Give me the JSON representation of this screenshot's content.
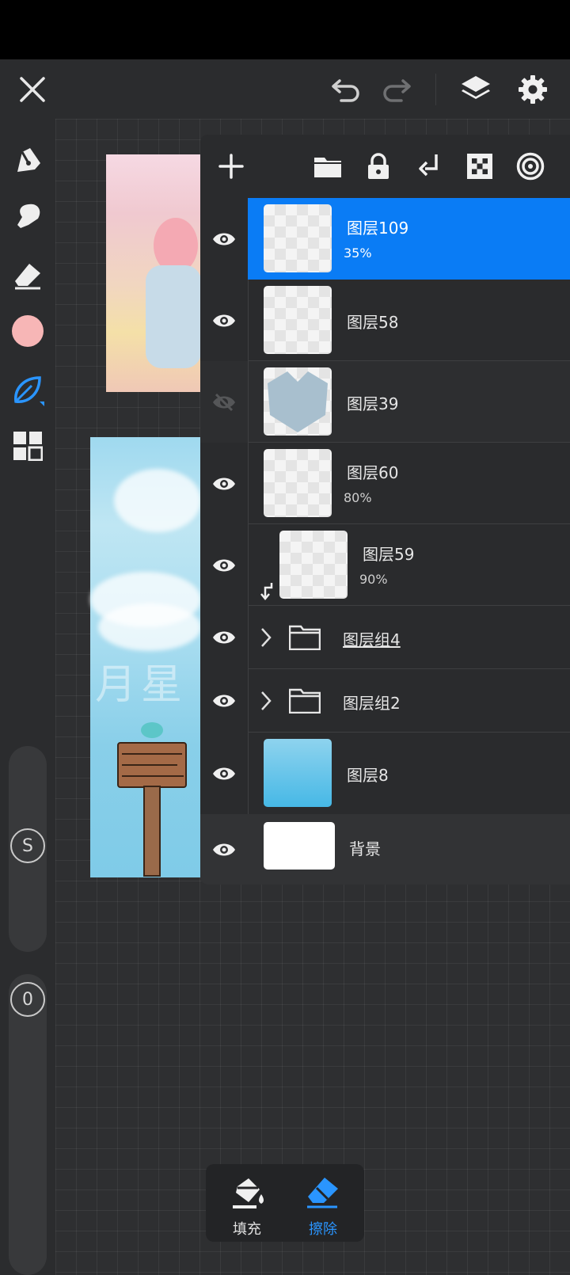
{
  "top_bar": {
    "close_icon": "close-icon",
    "undo_icon": "undo-icon",
    "redo_icon": "redo-icon",
    "layers_icon": "layers-icon",
    "settings_icon": "gear-icon"
  },
  "left_toolbar": {
    "tools": [
      "brush-icon",
      "smudge-icon",
      "eraser-icon",
      "color-swatch",
      "leaf-brush-icon",
      "grid-menu-icon"
    ],
    "active_tool": "leaf-brush-icon",
    "current_color": "#f7b6b6",
    "size_slider_label": "S",
    "opacity_slider_label": "0"
  },
  "artwork": {
    "watermark": "月星"
  },
  "layers_panel": {
    "toolbar": [
      "add-layer-icon",
      "folder-icon",
      "lock-icon",
      "merge-down-icon",
      "alpha-lock-icon",
      "blend-mode-icon"
    ],
    "layers": [
      {
        "name": "图层109",
        "opacity": "35%",
        "selected": true,
        "visible": true
      },
      {
        "name": "图层58",
        "opacity": "",
        "selected": false,
        "visible": true
      },
      {
        "name": "图层39",
        "opacity": "",
        "selected": false,
        "visible": false
      },
      {
        "name": "图层60",
        "opacity": "80%",
        "selected": false,
        "visible": true
      },
      {
        "name": "图层59",
        "opacity": "90%",
        "selected": false,
        "visible": true,
        "clipped": true
      },
      {
        "name": "图层组4",
        "group": true,
        "visible": true
      },
      {
        "name": "图层组2",
        "group": true,
        "visible": true
      },
      {
        "name": "图层8",
        "opacity": "",
        "visible": true
      },
      {
        "name": "背景",
        "opacity": "",
        "visible": true
      }
    ]
  },
  "fill_erase": {
    "fill_label": "填充",
    "erase_label": "擦除",
    "active": "erase"
  },
  "colors": {
    "accent": "#0a7cf5",
    "active_icon": "#2a95ff"
  }
}
